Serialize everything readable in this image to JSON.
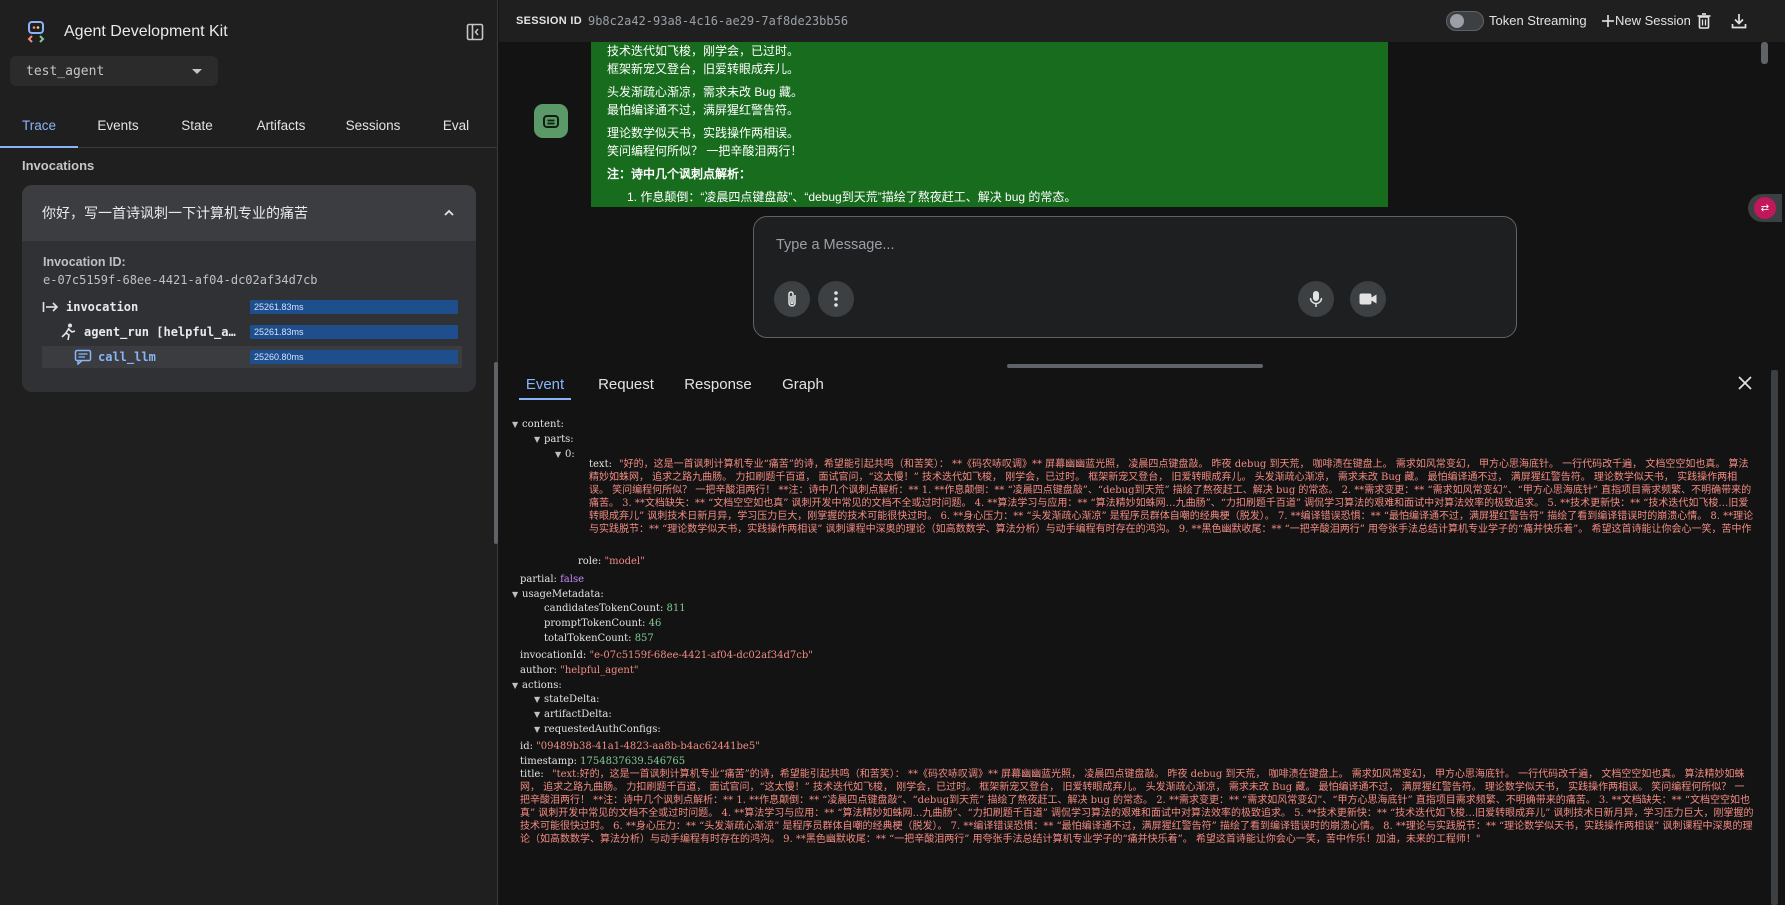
{
  "app": {
    "title": "Agent Development Kit",
    "agent": "test_agent"
  },
  "sidebar": {
    "tabs": [
      {
        "label": "Trace",
        "active": true
      },
      {
        "label": "Events"
      },
      {
        "label": "State"
      },
      {
        "label": "Artifacts"
      },
      {
        "label": "Sessions"
      },
      {
        "label": "Eval"
      }
    ],
    "section": "Invocations",
    "invocation": {
      "question": "你好，写一首诗讽刺一下计算机专业的痛苦",
      "id_label": "Invocation ID:",
      "id": "e-07c5159f-68ee-4421-af04-dc02af34d7cb",
      "spans": [
        {
          "name": "invocation",
          "duration": "25261.83ms",
          "icon": "arrow-into-icon"
        },
        {
          "name": "agent_run [helpful_agent]",
          "duration": "25261.83ms",
          "icon": "running-person-icon"
        },
        {
          "name": "call_llm",
          "duration": "25260.80ms",
          "icon": "chat-bubble-icon"
        }
      ]
    }
  },
  "topbar": {
    "session_label": "SESSION ID",
    "session_id": "9b8c2a42-93a8-4c16-ae29-7af8de23bb56",
    "token_streaming": "Token Streaming",
    "new_session": "New Session"
  },
  "chat": {
    "lines": [
      "技术迭代如飞梭，刚学会，已过时。",
      "框架新宠又登台，旧爱转眼成弃儿。",
      "头发渐疏心渐凉，需求未改 Bug 藏。",
      "最怕编译通不过，满屏猩红警告符。",
      "理论数学似天书，实践操作两相误。",
      "笑问编程何所似？ 一把辛酸泪两行！"
    ],
    "note": "注：诗中几个讽刺点解析：",
    "list_item": "1. 作息颠倒：“凌晨四点键盘敲”、“debug到天荒”描绘了熬夜赶工、解决 bug 的常态。",
    "placeholder": "Type a Message..."
  },
  "event": {
    "tabs": [
      {
        "label": "Event",
        "active": true
      },
      {
        "label": "Request"
      },
      {
        "label": "Response"
      },
      {
        "label": "Graph"
      }
    ],
    "keys": {
      "content": "content:",
      "parts": "parts:",
      "zero": "0:",
      "text": "text:",
      "role": "role:",
      "partial": "partial:",
      "usageMetadata": "usageMetadata:",
      "candidatesTokenCount": "candidatesTokenCount:",
      "promptTokenCount": "promptTokenCount:",
      "totalTokenCount": "totalTokenCount:",
      "invocationId": "invocationId:",
      "author": "author:",
      "actions": "actions:",
      "stateDelta": "stateDelta:",
      "artifactDelta": "artifactDelta:",
      "requestedAuthConfigs": "requestedAuthConfigs:",
      "id": "id:",
      "timestamp": "timestamp:",
      "title": "title:"
    },
    "text_value": "\"好的，这是一首讽刺计算机专业“痛苦”的诗，希望能引起共鸣（和苦笑）： **《码农哧叹调》** 屏幕幽幽蓝光照， 凌晨四点键盘敲。 昨夜 debug 到天荒， 咖啡渍在键盘上。 需求如风常变幻， 甲方心思海底针。 一行代码改千遍， 文档空空如也真。 算法精妙如蛛网， 追求之路九曲肠。 力扣刷题千百道， 面试官问，“这太慢！” 技术迭代如飞梭， 刚学会，已过时。 框架新宠又登台， 旧爱转眼成弃儿。 头发渐疏心渐凉， 需求未改 Bug 藏。 最怕编译通不过， 满屏猩红警告符。 理论数学似天书， 实践操作两相误。 笑问编程何所似？ 一把辛酸泪两行！ **注：诗中几个讽刺点解析：** 1. **作息颠倒：** “凌晨四点键盘敲”、“debug到天荒” 描绘了熬夜赶工、解决 bug 的常态。 2. **需求变更：** “需求如风常变幻”、“甲方心思海底针” 直指项目需求频繁、不明确带来的痛苦。 3. **文档缺失：** “文档空空如也真” 讽刺开发中常见的文档不全或过时问题。 4. **算法学习与应用：** “算法精妙如蛛网…九曲肠”、“力扣刷题千百道” 调侃学习算法的艰难和面试中对算法效率的极致追求。 5. **技术更新快：** “技术迭代如飞梭…旧爱转眼成弃儿” 讽刺技术日新月异，学习压力巨大，刚掌握的技术可能很快过时。 6. **身心压力：** “头发渐疏心渐凉” 是程序员群体自嘲的经典梗（脱发）。 7. **编译错误恐惧：** “最怕编译通不过，满屏猩红警告符” 描绘了看到编译错误时的崩溃心情。 8. **理论与实践脱节：** “理论数学似天书，实践操作两相误” 讽刺课程中深奥的理论（如高数数学、算法分析）与动手编程有时存在的鸿沟。 9. **黑色幽默收尾：** “一把辛酸泪两行” 用夸张手法总结计算机专业学子的“痛并快乐着”。 希望这首诗能让你会心一笑，苦中作乐！加油，未来的工程师！\"",
    "role": "\"model\"",
    "partial": "false",
    "candidatesTokenCount": "811",
    "promptTokenCount": "46",
    "totalTokenCount": "857",
    "invocationId": "\"e-07c5159f-68ee-4421-af04-dc02af34d7cb\"",
    "author": "\"helpful_agent\"",
    "id": "\"09489b38-41a1-4823-aa8b-b4ac62441be5\"",
    "timestamp": "1754837639.546765",
    "title_value": "\"text:好的，这是一首讽刺计算机专业“痛苦”的诗，希望能引起共鸣（和苦笑）： **《码农哧叹调》** 屏幕幽幽蓝光照， 凌晨四点键盘敲。 昨夜 debug 到天荒， 咖啡渍在键盘上。 需求如风常变幻， 甲方心思海底针。 一行代码改千遍， 文档空空如也真。 算法精妙如蛛网， 追求之路九曲肠。 力扣刷题千百道， 面试官问，“这太慢！” 技术迭代如飞梭， 刚学会，已过时。 框架新宠又登台， 旧爱转眼成弃儿。 头发渐疏心渐凉， 需求未改 Bug 藏。 最怕编译通不过， 满屏猩红警告符。 理论数学似天书， 实践操作两相误。 笑问编程何所似？ 一把辛酸泪两行！ **注：诗中几个讽刺点解析：** 1. **作息颠倒：** “凌晨四点键盘敲”、“debug到天荒” 描绘了熬夜赶工、解决 bug 的常态。 2. **需求变更：** “需求如风常变幻”、“甲方心思海底针” 直指项目需求频繁、不明确带来的痛苦。 3. **文档缺失：** “文档空空如也真” 讽刺开发中常见的文档不全或过时问题。 4. **算法学习与应用：** “算法精妙如蛛网…九曲肠”、“力扣刷题千百道” 调侃学习算法的艰难和面试中对算法效率的极致追求。 5. **技术更新快：** “技术迭代如飞梭…旧爱转眼成弃儿” 讽刺技术日新月异，学习压力巨大，刚掌握的技术可能很快过时。 6. **身心压力：** “头发渐疏心渐凉” 是程序员群体自嘲的经典梗（脱发）。 7. **编译错误恐惧：** “最怕编译通不过，满屏猩红警告符” 描绘了看到编译错误时的崩溃心情。 8. **理论与实践脱节：** “理论数学似天书，实践操作两相误” 讽刺课程中深奥的理论（如高数数学、算法分析）与动手编程有时存在的鸿沟。 9. **黑色幽默收尾：** “一把辛酸泪两行” 用夸张手法总结计算机专业学子的“痛并快乐着”。 希望这首诗能让你会心一笑，苦中作乐！加油，未来的工程师！\""
  },
  "colors": {
    "accent": "#8ab4f8",
    "bot_bubble": "#176c1d",
    "string": "#f28b82",
    "number": "#81c995",
    "boolean": "#c58af9"
  }
}
